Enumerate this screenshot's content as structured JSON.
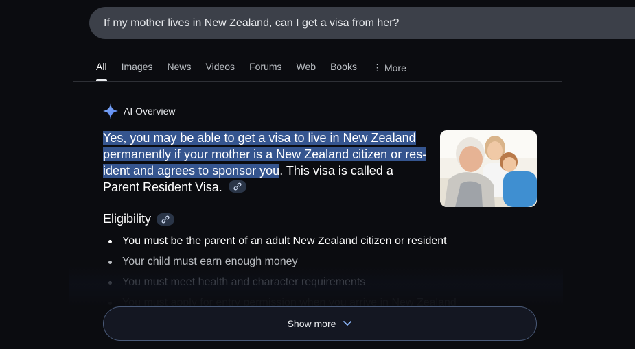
{
  "search": {
    "query": "If my mother lives in New Zealand, can I get a visa from her?"
  },
  "tabs": [
    {
      "label": "All",
      "active": true
    },
    {
      "label": "Images"
    },
    {
      "label": "News"
    },
    {
      "label": "Videos"
    },
    {
      "label": "Forums"
    },
    {
      "label": "Web"
    },
    {
      "label": "Books"
    },
    {
      "label": "More",
      "icon": "more-vert-icon"
    }
  ],
  "ai_overview": {
    "title": "AI Overview",
    "icon": "sparkle-icon",
    "answer": {
      "highlighted": "Yes, you may be able to get a visa to live in New Zealand permanently if your mother is a New Zealand citizen or res­ident and agrees to sponsor you",
      "rest": ". This visa is called a Parent Resident Visa."
    },
    "image": {
      "alt": "Elderly man with woman and child"
    },
    "section": {
      "title": "Eligibility",
      "bullets": [
        "You must be the parent of an adult New Zealand citizen or resident",
        "Your child must earn enough money",
        "You must meet health and character requirements",
        "You must apply for entry permission when you arrive in New Zealand"
      ]
    },
    "show_more": "Show more"
  },
  "colors": {
    "background": "#0b0c10",
    "highlight": "#35558f",
    "searchbar": "#3c4049"
  }
}
